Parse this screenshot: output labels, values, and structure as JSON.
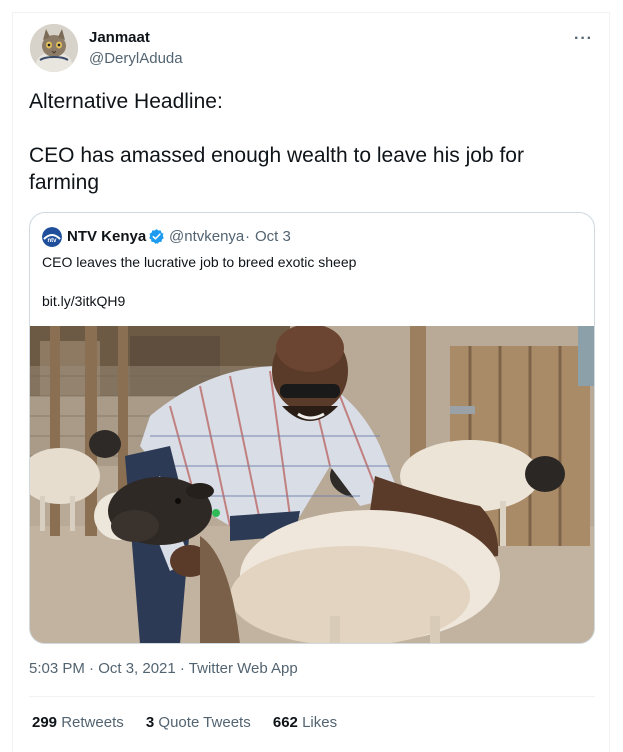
{
  "author": {
    "name": "Janmaat",
    "handle": "@DerylAduda"
  },
  "more_icon": "more-horizontal-icon",
  "tweet": {
    "text": "Alternative Headline:\n\nCEO has amassed enough wealth to leave his job for farming"
  },
  "quoted": {
    "name": "NTV Kenya",
    "handle": "@ntvkenya",
    "separator": "·",
    "date": "Oct 3",
    "text": "CEO leaves the lucrative job to breed exotic sheep",
    "link": "bit.ly/3itkQH9",
    "verified_icon": "verified-badge-icon",
    "verified_color": "#1d9bf0",
    "image_icon": "photo-man-with-sheep"
  },
  "meta": "5:03 PM · Oct 3, 2021 · Twitter Web App",
  "stats": {
    "retweets_count": "299",
    "retweets_label": "Retweets",
    "quotes_count": "3",
    "quotes_label": "Quote Tweets",
    "likes_count": "662",
    "likes_label": "Likes"
  }
}
